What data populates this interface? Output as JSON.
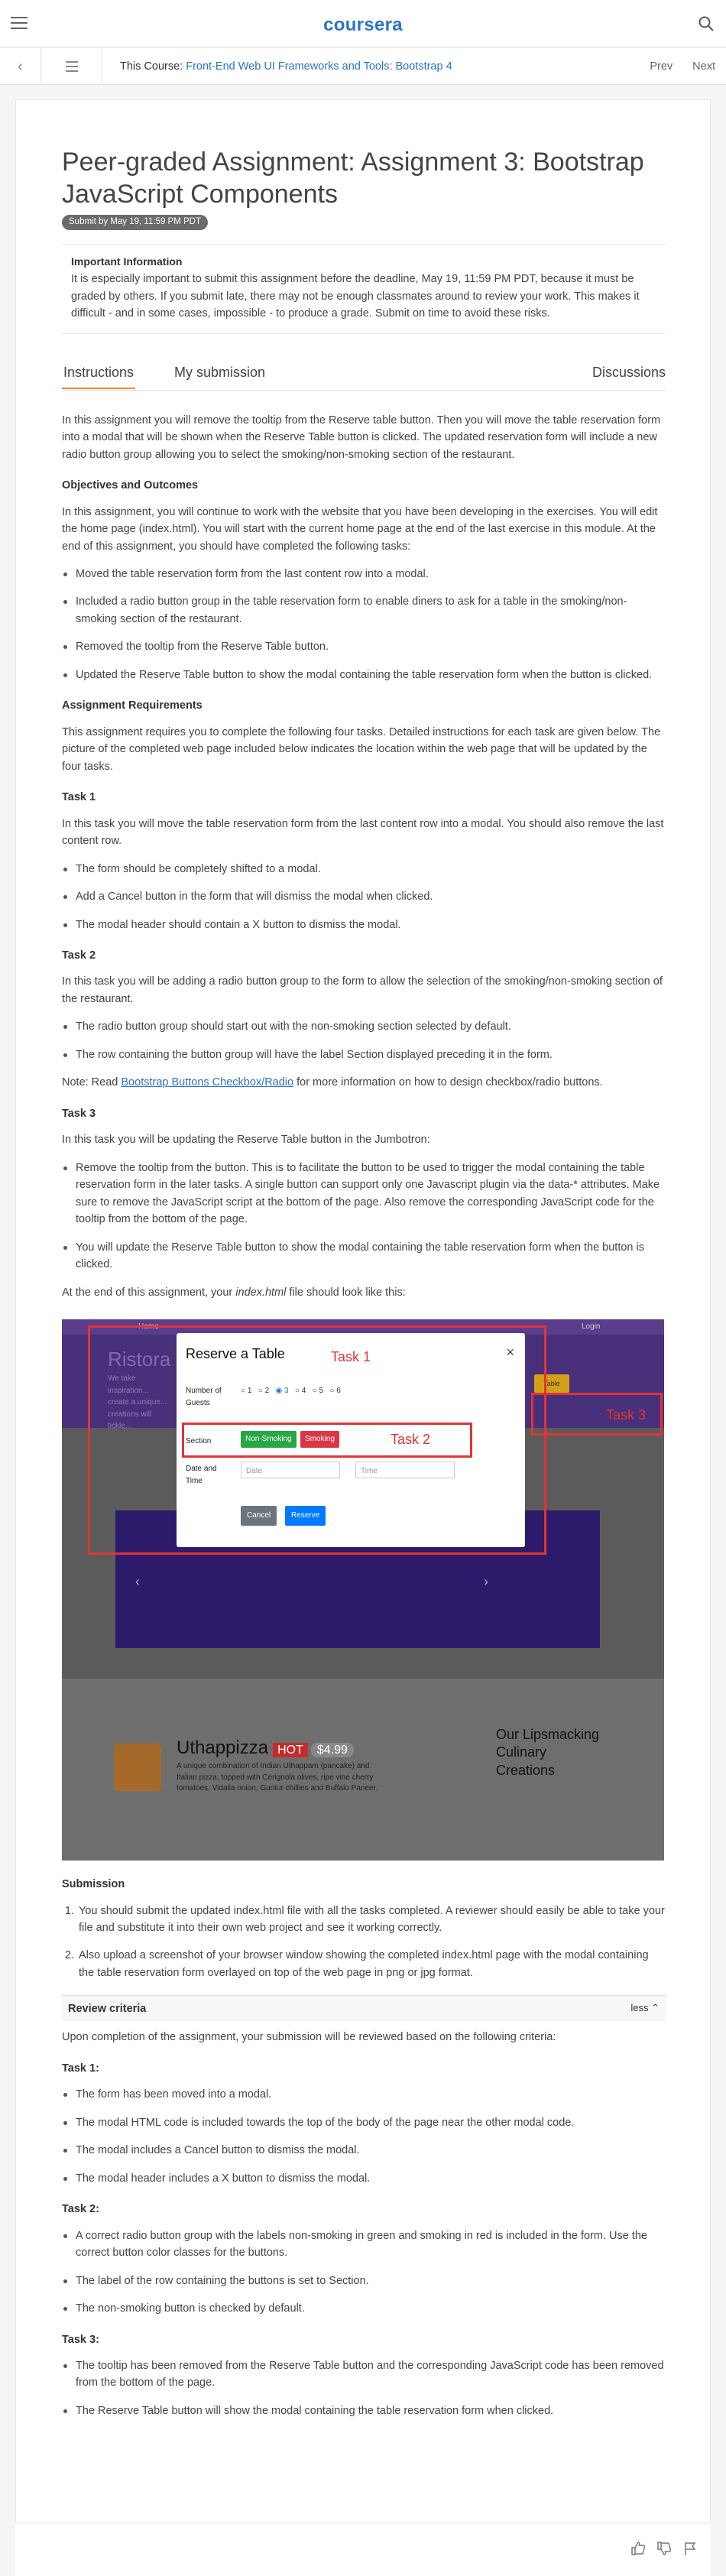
{
  "header": {
    "logo": "coursera"
  },
  "coursebar": {
    "prefix": "This Course: ",
    "course_link": "Front-End Web UI Frameworks and Tools: Bootstrap 4",
    "prev": "Prev",
    "next": "Next"
  },
  "assignment": {
    "title": "Peer-graded Assignment: Assignment 3: Bootstrap JavaScript Components",
    "deadline_badge": "Submit by May 19, 11:59 PM PDT",
    "info_title": "Important Information",
    "info_text": "It is especially important to submit this assignment before the deadline, May 19, 11:59 PM PDT, because it must be graded by others. If you submit late, there may not be enough classmates around to review your work. This makes it difficult - and in some cases, impossible - to produce a grade. Submit on time to avoid these risks."
  },
  "tabs": {
    "instructions": "Instructions",
    "my_submission": "My submission",
    "discussions": "Discussions"
  },
  "content": {
    "intro": "In this assignment you will remove the tooltip from the Reserve table button. Then you will move the table reservation form into a modal that will be shown when the Reserve Table button is clicked. The updated reservation form will include a new radio button group allowing you to select the smoking/non-smoking section of the restaurant.",
    "objectives_heading": "Objectives and Outcomes",
    "objectives_text": "In this assignment, you will continue to work with the website that you have been developing in the exercises. You will edit the home page (index.html). You will start with the current home page at the end of the last exercise in this module. At the end of this assignment, you should have completed the following tasks:",
    "objectives": [
      "Moved the table reservation form from the last content row into a modal.",
      "Included a radio button group in the table reservation form to enable diners to ask for a table in the smoking/non-smoking section of the restaurant.",
      "Removed the tooltip from the Reserve Table button.",
      "Updated the Reserve Table button to show the modal containing the table reservation form when the button is clicked."
    ],
    "requirements_heading": "Assignment Requirements",
    "requirements_text": "This assignment requires you to complete the following four tasks. Detailed instructions for each task are given below. The picture of the completed web page included below indicates the location within the web page that will be updated by the four tasks.",
    "task1_heading": "Task 1",
    "task1_text": "In this task you will move the table reservation form from the last content row into a modal. You should also remove the last content row.",
    "task1_items": [
      "The form should be completely shifted to a modal.",
      "Add a Cancel button in the form that will dismiss the modal when clicked.",
      "The modal header should contain a X button to dismiss the modal."
    ],
    "task2_heading": "Task 2",
    "task2_text": "In this task you will be adding a radio button group to the form to allow the selection of the smoking/non-smoking section of the restaurant.",
    "task2_items": [
      "The radio button group should start out with the non-smoking section selected by default.",
      "The row containing the button group will have the label Section displayed preceding it in the form."
    ],
    "note_prefix": "Note: Read ",
    "note_link": "Bootstrap Buttons Checkbox/Radio",
    "note_suffix": " for more information on how to design checkbox/radio buttons.",
    "task3_heading": "Task 3",
    "task3_text": "In this task you will be updating the Reserve Table button in the Jumbotron:",
    "task3_items": [
      "Remove the tooltip from the button. This is to facilitate the button to be used to trigger the modal containing the table reservation form in the later tasks. A single button can support only one Javascript plugin via the data-* attributes. Make sure to remove the JavaScript script at the bottom of the page. Also remove the corresponding JavaScript code for the tooltip from the bottom of the page.",
      "You will update the Reserve Table button to show the modal containing the table reservation form when the button is clicked."
    ],
    "end_prefix": "At the end of this assignment, your ",
    "end_em": "index.html",
    "end_suffix": " file should look like this:"
  },
  "screenshot": {
    "nav_home": "Home",
    "nav_login": "Login",
    "jumbo_title": "Ristora",
    "jumbo_text": "We take inspiration... create a unique... creations will tickle...",
    "modal_title": "Reserve a Table",
    "guests_label": "Number of Guests",
    "guest_options": [
      "1",
      "2",
      "3",
      "4",
      "5",
      "6"
    ],
    "section_label": "Section",
    "non_smoking": "Non-Smoking",
    "smoking": "Smoking",
    "date_time_label": "Date and Time",
    "date_placeholder": "Date",
    "time_placeholder": "Time",
    "cancel": "Cancel",
    "reserve": "Reserve",
    "reserve_table_btn": "Table",
    "task1_label": "Task 1",
    "task2_label": "Task 2",
    "task3_label": "Task 3",
    "dish_name": "Uthappizza",
    "hot": "HOT",
    "price": "$4.99",
    "dish_desc": "A unique combination of Indian Uthappam (pancake) and Italian pizza, topped with Cerignola olives, ripe vine cherry tomatoes, Vidalia onion, Guntur chillies and Buffalo Paneer.",
    "quote": "Our Lipsmacking Culinary Creations"
  },
  "submission": {
    "heading": "Submission",
    "items": [
      "You should submit the updated index.html file with all the tasks completed. A reviewer should easily be able to take your file and substitute it into their own web project and see it working correctly.",
      "Also upload a screenshot of your browser window showing the completed index.html page with the modal containing the table reservation form overlayed on top of the web page in png or jpg format."
    ]
  },
  "review": {
    "heading": "Review criteria",
    "toggle": "less",
    "intro": "Upon completion of the assignment, your submission will be reviewed based on the following criteria:",
    "task1_heading": "Task 1:",
    "task1_items": [
      "The form has been moved into a modal.",
      "The modal HTML code is included towards the top of the body of the page near the other modal code.",
      "The modal includes a Cancel button to dismiss the modal.",
      "The modal header includes a X button to dismiss the modal."
    ],
    "task2_heading": "Task 2:",
    "task2_items": [
      "A correct radio button group with the labels non-smoking in green and smoking in red is included in the form. Use the correct button color classes for the buttons.",
      "The label of the row containing the buttons is set to Section.",
      "The non-smoking button is checked by default."
    ],
    "task3_heading": "Task 3:",
    "task3_items": [
      "The tooltip has been removed from the Reserve Table button and the corresponding JavaScript code has been removed from the bottom of the page.",
      "The Reserve Table button will show the modal containing the table reservation form when clicked."
    ]
  }
}
